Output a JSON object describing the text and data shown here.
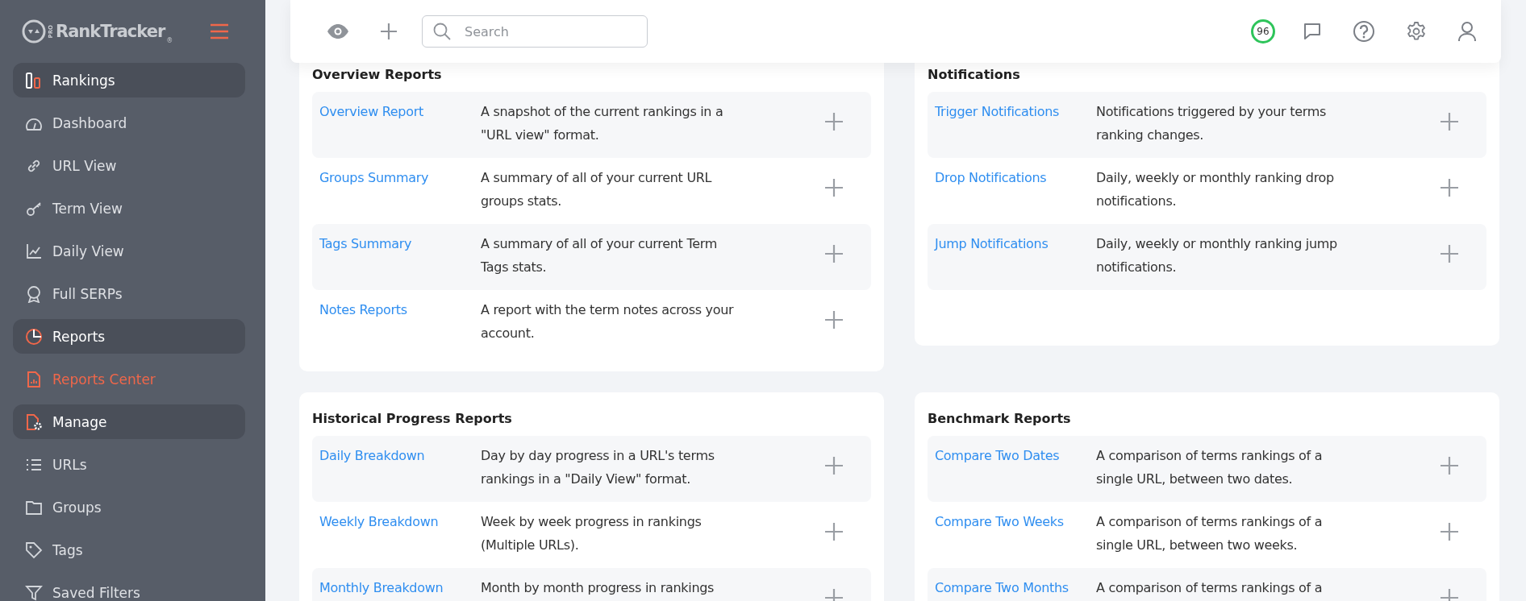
{
  "sidebar": {
    "logo": {
      "badge": "PRO",
      "name": "RankTracker",
      "mark": "®"
    },
    "sections": [
      {
        "label": "Rankings",
        "items": [
          {
            "label": "Dashboard",
            "selected": false
          },
          {
            "label": "URL View",
            "selected": false
          },
          {
            "label": "Term View",
            "selected": false
          },
          {
            "label": "Daily View",
            "selected": false
          },
          {
            "label": "Full SERPs",
            "selected": false
          }
        ]
      },
      {
        "label": "Reports",
        "items": [
          {
            "label": "Reports Center",
            "selected": true
          }
        ]
      },
      {
        "label": "Manage",
        "items": [
          {
            "label": "URLs",
            "selected": false
          },
          {
            "label": "Groups",
            "selected": false
          },
          {
            "label": "Tags",
            "selected": false
          },
          {
            "label": "Saved Filters",
            "selected": false
          }
        ]
      }
    ]
  },
  "topbar": {
    "search": {
      "placeholder": "Search"
    },
    "score": "96"
  },
  "cards": [
    {
      "title": "Overview Reports",
      "reports": [
        {
          "name": "Overview Report",
          "description": "A snapshot of the current rankings in a \"URL view\" format."
        },
        {
          "name": "Groups Summary",
          "description": "A summary of all of your current URL groups stats."
        },
        {
          "name": "Tags Summary",
          "description": "A summary of all of your current Term Tags stats."
        },
        {
          "name": "Notes Reports",
          "description": "A report with the term notes across your account."
        }
      ]
    },
    {
      "title": "Notifications",
      "reports": [
        {
          "name": "Trigger Notifications",
          "description": "Notifications triggered by your terms ranking changes."
        },
        {
          "name": "Drop Notifications",
          "description": "Daily, weekly or monthly ranking drop notifications."
        },
        {
          "name": "Jump Notifications",
          "description": "Daily, weekly or monthly ranking jump notifications."
        }
      ]
    },
    {
      "title": "Historical Progress Reports",
      "reports": [
        {
          "name": "Daily Breakdown",
          "description": "Day by day progress in a URL's terms rankings in a \"Daily View\" format."
        },
        {
          "name": "Weekly Breakdown",
          "description": "Week by week progress in rankings (Multiple URLs)."
        },
        {
          "name": "Monthly Breakdown",
          "description": "Month by month progress in rankings"
        }
      ]
    },
    {
      "title": "Benchmark Reports",
      "reports": [
        {
          "name": "Compare Two Dates",
          "description": "A comparison of terms rankings of a single URL, between two dates."
        },
        {
          "name": "Compare Two Weeks",
          "description": "A comparison of terms rankings of a single URL, between two weeks."
        },
        {
          "name": "Compare Two Months",
          "description": "A comparison of terms rankings of a"
        }
      ]
    }
  ]
}
